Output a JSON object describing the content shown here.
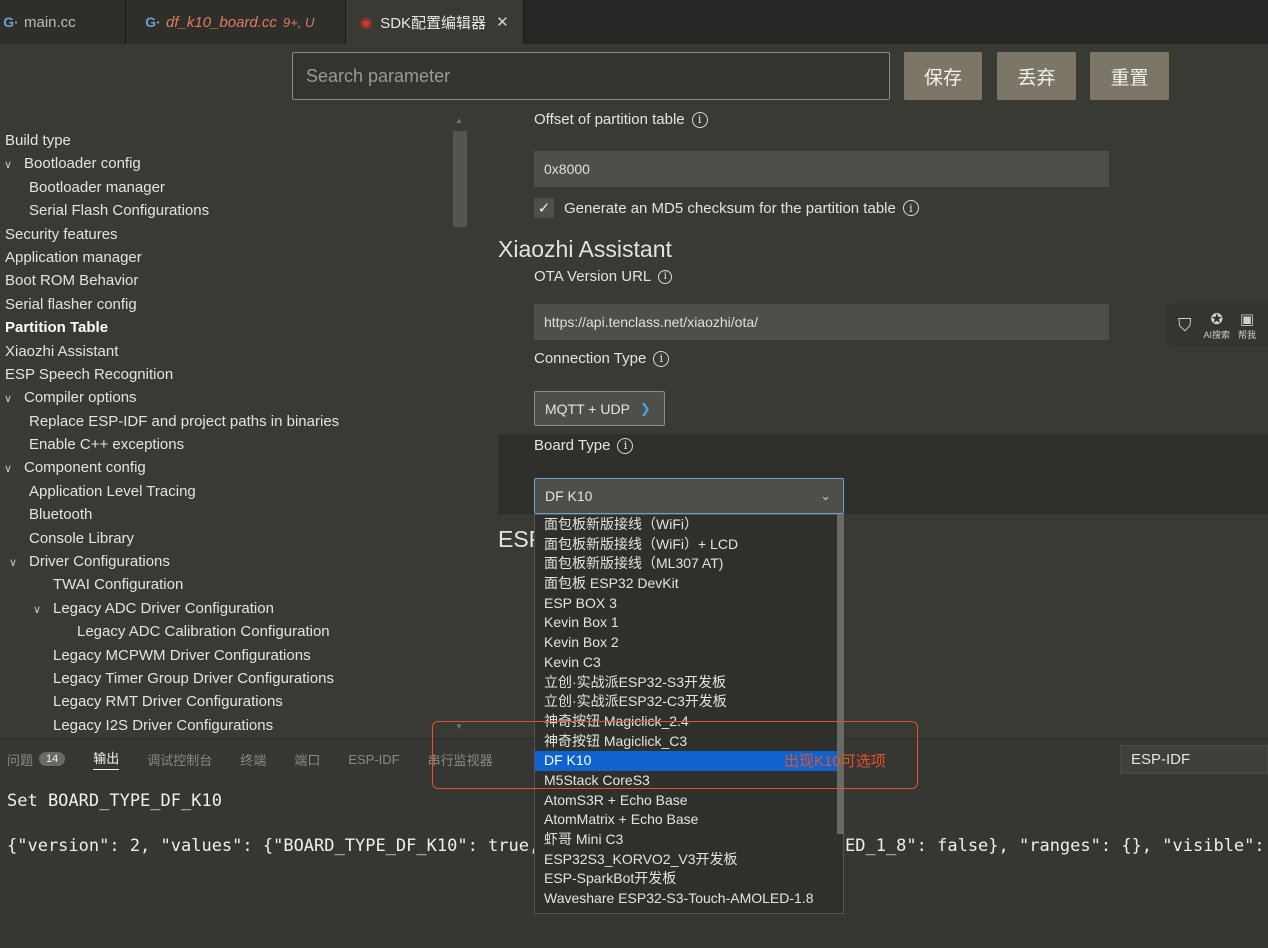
{
  "tabs": [
    {
      "label": "main.cc"
    },
    {
      "label": "df_k10_board.cc",
      "status": "9+, U"
    },
    {
      "label": "SDK配置编辑器",
      "close": "✕"
    }
  ],
  "toolbar": {
    "search_placeholder": "Search parameter",
    "save": "保存",
    "discard": "丢弃",
    "reset": "重置"
  },
  "tree": [
    {
      "label": "Build type",
      "indent": 0,
      "chev": false
    },
    {
      "label": "Bootloader config",
      "indent": 0,
      "chev": true
    },
    {
      "label": "Bootloader manager",
      "indent": 1,
      "chev": false
    },
    {
      "label": "Serial Flash Configurations",
      "indent": 1,
      "chev": false
    },
    {
      "label": "Security features",
      "indent": 0,
      "chev": false
    },
    {
      "label": "Application manager",
      "indent": 0,
      "chev": false
    },
    {
      "label": "Boot ROM Behavior",
      "indent": 0,
      "chev": false
    },
    {
      "label": "Serial flasher config",
      "indent": 0,
      "chev": false
    },
    {
      "label": "Partition Table",
      "indent": 0,
      "chev": false,
      "bold": true
    },
    {
      "label": "Xiaozhi Assistant",
      "indent": 0,
      "chev": false
    },
    {
      "label": "ESP Speech Recognition",
      "indent": 0,
      "chev": false
    },
    {
      "label": "Compiler options",
      "indent": 0,
      "chev": true
    },
    {
      "label": "Replace ESP-IDF and project paths in binaries",
      "indent": 1,
      "chev": false
    },
    {
      "label": "Enable C++ exceptions",
      "indent": 1,
      "chev": false
    },
    {
      "label": "Component config",
      "indent": 0,
      "chev": true
    },
    {
      "label": "Application Level Tracing",
      "indent": 1,
      "chev": false
    },
    {
      "label": "Bluetooth",
      "indent": 1,
      "chev": false
    },
    {
      "label": "Console Library",
      "indent": 1,
      "chev": false
    },
    {
      "label": "Driver Configurations",
      "indent": 1,
      "chev": true
    },
    {
      "label": "TWAI Configuration",
      "indent": 2,
      "chev": false
    },
    {
      "label": "Legacy ADC Driver Configuration",
      "indent": 2,
      "chev": true
    },
    {
      "label": "Legacy ADC Calibration Configuration",
      "indent": 3,
      "chev": false
    },
    {
      "label": "Legacy MCPWM Driver Configurations",
      "indent": 2,
      "chev": false
    },
    {
      "label": "Legacy Timer Group Driver Configurations",
      "indent": 2,
      "chev": false
    },
    {
      "label": "Legacy RMT Driver Configurations",
      "indent": 2,
      "chev": false
    },
    {
      "label": "Legacy I2S Driver Configurations",
      "indent": 2,
      "chev": false
    }
  ],
  "settings": {
    "offset_label": "Offset of partition table",
    "offset_value": "0x8000",
    "md5_label": "Generate an MD5 checksum for the partition table",
    "md5_checked": true,
    "section_xiaozhi": "Xiaozhi Assistant",
    "ota_label": "OTA Version URL",
    "ota_value": "https://api.tenclass.net/xiaozhi/ota/",
    "conn_label": "Connection Type",
    "conn_value": "MQTT + UDP",
    "board_label": "Board Type",
    "board_value": "DF K10",
    "section_esp": "ESP"
  },
  "board_options": [
    "面包板新版接线（WiFi）",
    "面包板新版接线（WiFi）+ LCD",
    "面包板新版接线（ML307 AT)",
    "面包板 ESP32 DevKit",
    "ESP BOX 3",
    "Kevin Box 1",
    "Kevin Box 2",
    "Kevin C3",
    "立创·实战派ESP32-S3开发板",
    "立创·实战派ESP32-C3开发板",
    "神奇按钮 Magiclick_2.4",
    "神奇按钮 Magiclick_C3",
    "DF K10",
    "M5Stack CoreS3",
    "AtomS3R + Echo Base",
    "AtomMatrix + Echo Base",
    "虾哥 Mini C3",
    "ESP32S3_KORVO2_V3开发板",
    "ESP-SparkBot开发板",
    "Waveshare ESP32-S3-Touch-AMOLED-1.8"
  ],
  "selected_option_index": 12,
  "widget": {
    "ai_search": "AI搜索",
    "help": "帮我"
  },
  "panel": {
    "tabs": [
      "问题",
      "输出",
      "调试控制台",
      "终端",
      "端口",
      "ESP-IDF",
      "串行监视器"
    ],
    "problems_count": "14",
    "output_source": "ESP-IDF",
    "line1": "Set BOARD_TYPE_DF_K10",
    "line2": "{\"version\": 2, \"values\": {\"BOARD_TYPE_DF_K10\": true,",
    "line2b": "ED_1_8\": false}, \"ranges\": {}, \"visible\": "
  },
  "annotation": "出现K10可选项",
  "colors": {
    "accent": "#0f63cf",
    "annotation": "#e0532e",
    "button": "#7b7668"
  }
}
